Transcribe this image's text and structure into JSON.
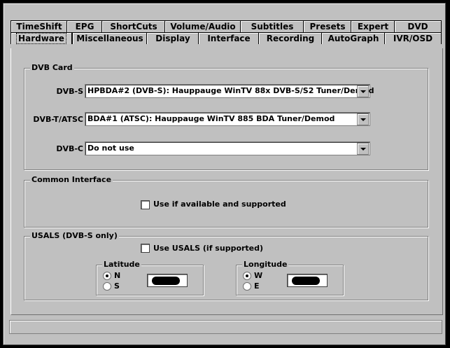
{
  "tabs_row1": [
    "TimeShift",
    "EPG",
    "ShortCuts",
    "Volume/Audio",
    "Subtitles",
    "Presets",
    "Expert",
    "DVD"
  ],
  "tabs_row2": [
    "Hardware",
    "Miscellaneous",
    "Display",
    "Interface",
    "Recording",
    "AutoGraph",
    "IVR/OSD"
  ],
  "active_tab": "Hardware",
  "dvb_card": {
    "title": "DVB Card",
    "dvbs_label": "DVB-S",
    "dvbs_value": "HPBDA#2 (DVB-S): Hauppauge WinTV 88x DVB-S/S2 Tuner/Demod",
    "dvbt_label": "DVB-T/ATSC",
    "dvbt_value": "BDA#1 (ATSC): Hauppauge WinTV 885 BDA Tuner/Demod",
    "dvbc_label": "DVB-C",
    "dvbc_value": "Do not use"
  },
  "common_interface": {
    "title": "Common Interface",
    "checkbox_label": "Use if available and supported",
    "checked": false
  },
  "usals": {
    "title": "USALS (DVB-S only)",
    "checkbox_label": "Use USALS (if supported)",
    "checked": false,
    "latitude": {
      "title": "Latitude",
      "opt1": "N",
      "opt2": "S",
      "selected": "N"
    },
    "longitude": {
      "title": "Longitude",
      "opt1": "W",
      "opt2": "E",
      "selected": "W"
    }
  }
}
